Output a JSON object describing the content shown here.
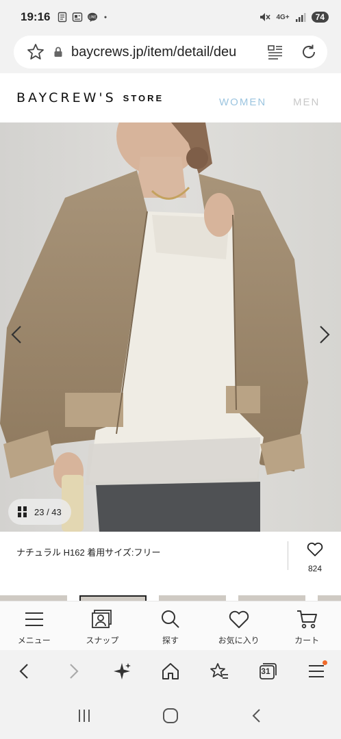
{
  "status": {
    "time": "19:16",
    "battery": "74",
    "network": "4G+"
  },
  "browser": {
    "url": "baycrews.jp/item/detail/deu"
  },
  "site": {
    "logo": "BAYCREW'S",
    "logo_sub": "STORE",
    "nav": [
      {
        "label": "WOMEN"
      },
      {
        "label": "MEN"
      }
    ]
  },
  "gallery": {
    "current": "23",
    "total": "43",
    "counter": "23 / 43"
  },
  "product": {
    "caption": "ナチュラル H162 着用サイズ:フリー",
    "favorite_count": "824"
  },
  "site_nav": [
    {
      "label": "メニュー",
      "icon": "menu-icon"
    },
    {
      "label": "スナップ",
      "icon": "snap-icon"
    },
    {
      "label": "探す",
      "icon": "search-icon"
    },
    {
      "label": "お気に入り",
      "icon": "heart-icon"
    },
    {
      "label": "カート",
      "icon": "cart-icon"
    }
  ],
  "browser_toolbar": {
    "tabs_count": "31"
  },
  "colors": {
    "nav_active": "#9cc5e0",
    "notif_dot": "#f06a2a"
  }
}
